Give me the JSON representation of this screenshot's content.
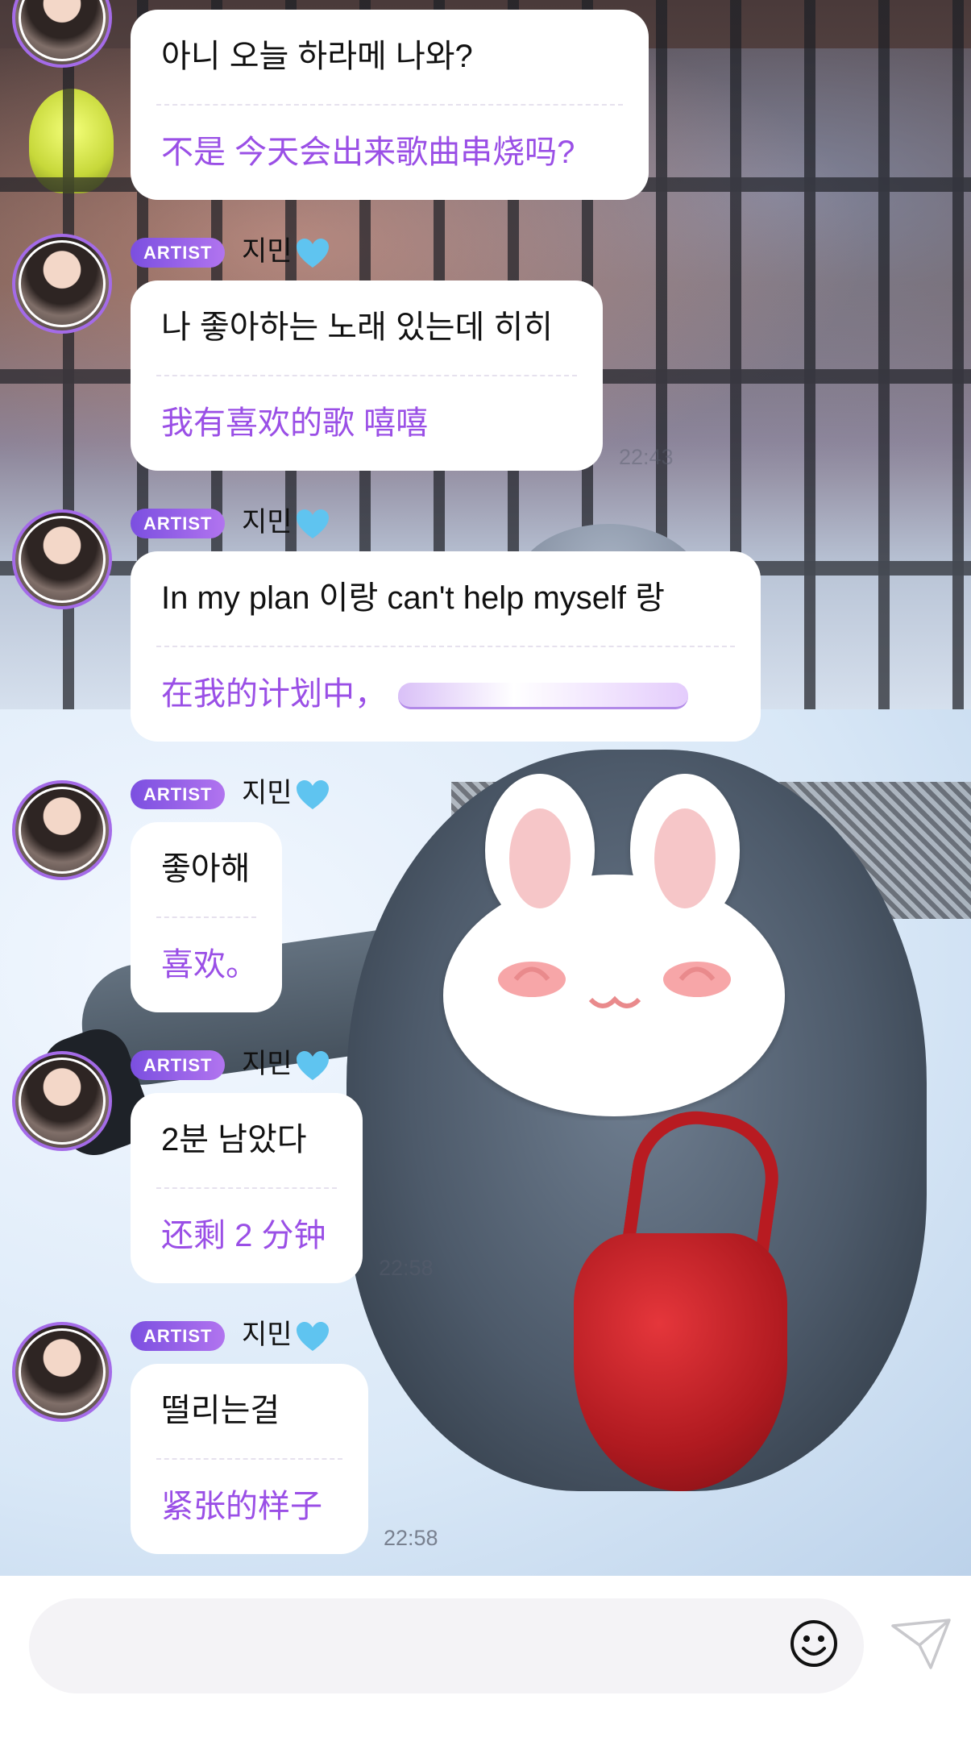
{
  "colors": {
    "accent": "#9a4fe6",
    "badge_start": "#7b4fe0",
    "badge_end": "#b174ef",
    "heart": "#5fc4f0",
    "bubble_bg": "#ffffff"
  },
  "sender_name": "지민",
  "badge_label": "ARTIST",
  "messages": [
    {
      "ko": "아니 오늘 하라메 나와?",
      "zh": "不是 今天会出来歌曲串烧吗?"
    },
    {
      "ko": "나 좋아하는 노래 있는데 히히",
      "zh": "我有喜欢的歌 嘻嘻",
      "time": "22:43"
    },
    {
      "ko": "In my plan 이랑 can't help myself 랑",
      "zh": "在我的计划中，"
    },
    {
      "ko": "좋아해",
      "zh": "喜欢。"
    },
    {
      "ko": "2분 남았다",
      "zh": "还剩 2 分钟",
      "time": "22:58"
    },
    {
      "ko": "떨리는걸",
      "zh": "紧张的样子",
      "time": "22:58"
    }
  ],
  "composer": {
    "placeholder": "",
    "emoji_icon": "smiley-icon",
    "send_icon": "paper-plane-icon"
  }
}
